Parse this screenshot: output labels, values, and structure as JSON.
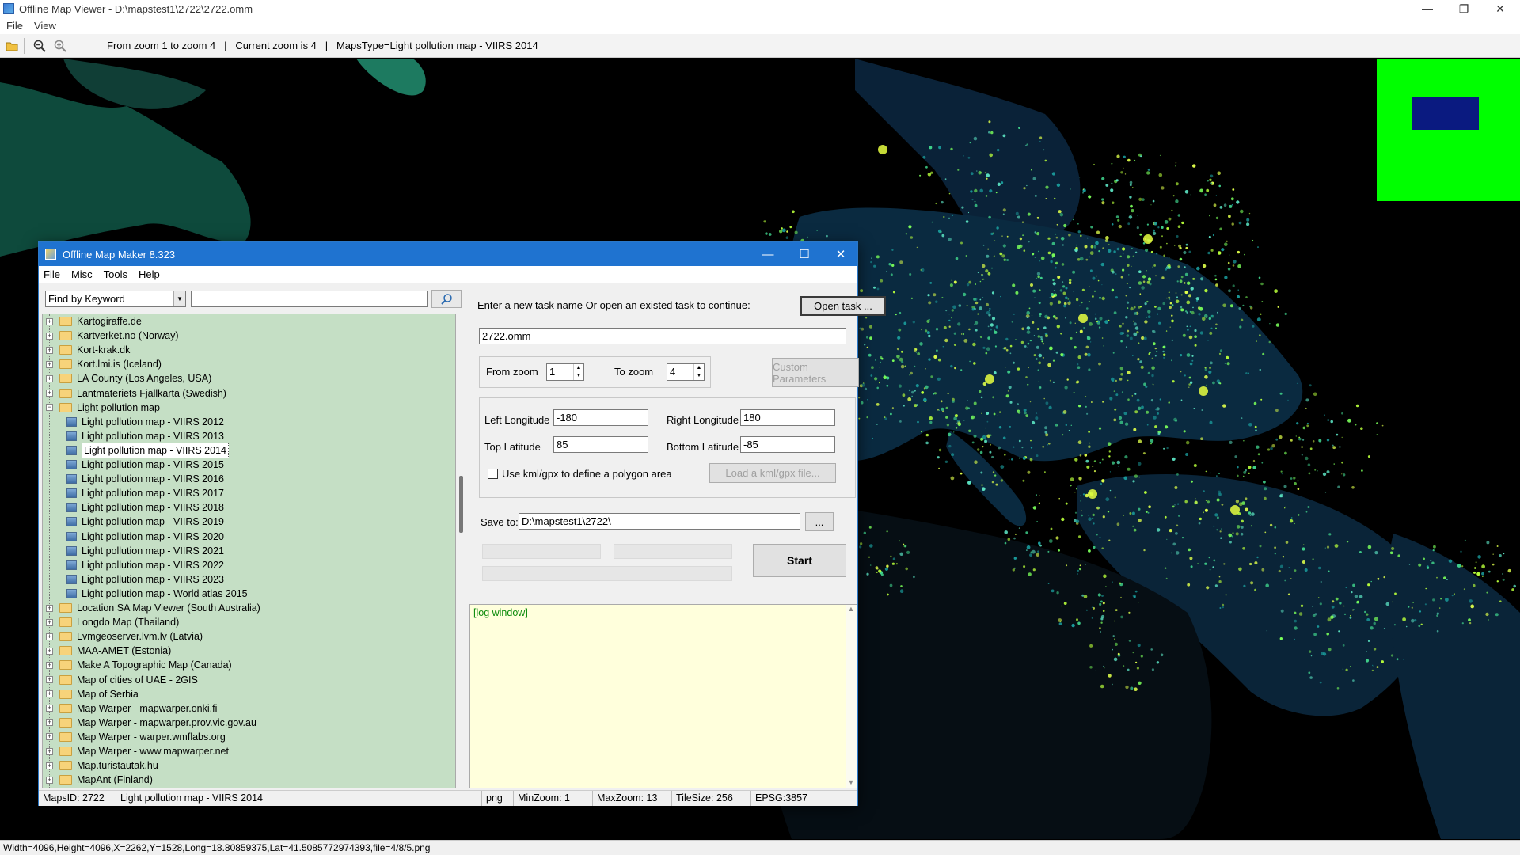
{
  "viewer": {
    "title": "Offline Map Viewer - D:\\mapstest1\\2722\\2722.omm",
    "menu": [
      "File",
      "View"
    ],
    "toolbar_info": "From zoom 1 to zoom 4   |   Current zoom is 4   |   MapsType=Light pollution map - VIIRS 2014",
    "statusbar": "Width=4096,Height=4096,X=2262,Y=1528,Long=18.80859375,Lat=41.5085772974393,file=4/8/5.png"
  },
  "dialog": {
    "title": "Offline Map Maker 8.323",
    "menu": [
      "File",
      "Misc",
      "Tools",
      "Help"
    ],
    "search_mode": "Find by Keyword",
    "tree": [
      {
        "label": "Kartogiraffe.de",
        "type": "folder"
      },
      {
        "label": "Kartverket.no (Norway)",
        "type": "folder"
      },
      {
        "label": "Kort-krak.dk",
        "type": "folder"
      },
      {
        "label": "Kort.lmi.is (Iceland)",
        "type": "folder"
      },
      {
        "label": "LA County (Los Angeles, USA)",
        "type": "folder"
      },
      {
        "label": "Lantmateriets Fjallkarta (Swedish)",
        "type": "folder"
      },
      {
        "label": "Light pollution map",
        "type": "folder-open"
      },
      {
        "label": "Light pollution map - VIIRS 2012",
        "type": "map"
      },
      {
        "label": "Light pollution map - VIIRS 2013",
        "type": "map"
      },
      {
        "label": "Light pollution map - VIIRS 2014",
        "type": "map",
        "selected": true
      },
      {
        "label": "Light pollution map - VIIRS 2015",
        "type": "map"
      },
      {
        "label": "Light pollution map - VIIRS 2016",
        "type": "map"
      },
      {
        "label": "Light pollution map - VIIRS 2017",
        "type": "map"
      },
      {
        "label": "Light pollution map - VIIRS 2018",
        "type": "map"
      },
      {
        "label": "Light pollution map - VIIRS 2019",
        "type": "map"
      },
      {
        "label": "Light pollution map - VIIRS 2020",
        "type": "map"
      },
      {
        "label": "Light pollution map - VIIRS 2021",
        "type": "map"
      },
      {
        "label": "Light pollution map - VIIRS 2022",
        "type": "map"
      },
      {
        "label": "Light pollution map - VIIRS 2023",
        "type": "map"
      },
      {
        "label": "Light pollution map - World atlas 2015",
        "type": "map"
      },
      {
        "label": "Location SA Map Viewer (South Australia)",
        "type": "folder"
      },
      {
        "label": "Longdo Map (Thailand)",
        "type": "folder"
      },
      {
        "label": "Lvmgeoserver.lvm.lv (Latvia)",
        "type": "folder"
      },
      {
        "label": "MAA-AMET (Estonia)",
        "type": "folder"
      },
      {
        "label": "Make A Topographic Map (Canada)",
        "type": "folder"
      },
      {
        "label": "Map of cities of UAE - 2GIS",
        "type": "folder"
      },
      {
        "label": "Map of Serbia",
        "type": "folder"
      },
      {
        "label": "Map Warper - mapwarper.onki.fi",
        "type": "folder"
      },
      {
        "label": "Map Warper - mapwarper.prov.vic.gov.au",
        "type": "folder"
      },
      {
        "label": "Map Warper - warper.wmflabs.org",
        "type": "folder"
      },
      {
        "label": "Map Warper - www.mapwarper.net",
        "type": "folder"
      },
      {
        "label": "Map.turistautak.hu",
        "type": "folder"
      },
      {
        "label": "MapAnt (Finland)",
        "type": "folder"
      }
    ],
    "task_prompt": "Enter a new task name Or open an existed task to continue:",
    "open_task_label": "Open task ...",
    "task_name": "2722.omm",
    "from_zoom_label": "From zoom",
    "from_zoom": "1",
    "to_zoom_label": "To zoom",
    "to_zoom": "4",
    "custom_params_label": "Custom Parameters",
    "left_lon_label": "Left Longitude",
    "left_lon": "-180",
    "right_lon_label": "Right Longitude",
    "right_lon": "180",
    "top_lat_label": "Top Latitude",
    "top_lat": "85",
    "bottom_lat_label": "Bottom Latitude",
    "bottom_lat": "-85",
    "kml_label": "Use kml/gpx to define a polygon area",
    "load_kml_label": "Load a kml/gpx file...",
    "save_to_label": "Save to:",
    "save_to": "D:\\mapstest1\\2722\\",
    "browse_label": "...",
    "start_label": "Start",
    "log_text": "[log window]",
    "status": {
      "maps_id": "MapsID: 2722",
      "map_name": "Light pollution map - VIIRS 2014",
      "format": "png",
      "min_zoom": "MinZoom: 1",
      "max_zoom": "MaxZoom: 13",
      "tile_size": "TileSize: 256",
      "epsg": "EPSG:3857"
    }
  },
  "colors": {
    "map_bg": "#000000",
    "light_green": "#b8ff3a",
    "light_teal": "#1f8a6a",
    "minimap_bg": "#00ff00",
    "minimap_view": "#0a1a80",
    "tree_bg": "#c5dfc5",
    "log_bg": "#ffffdc",
    "dialog_title": "#1f73d0"
  }
}
